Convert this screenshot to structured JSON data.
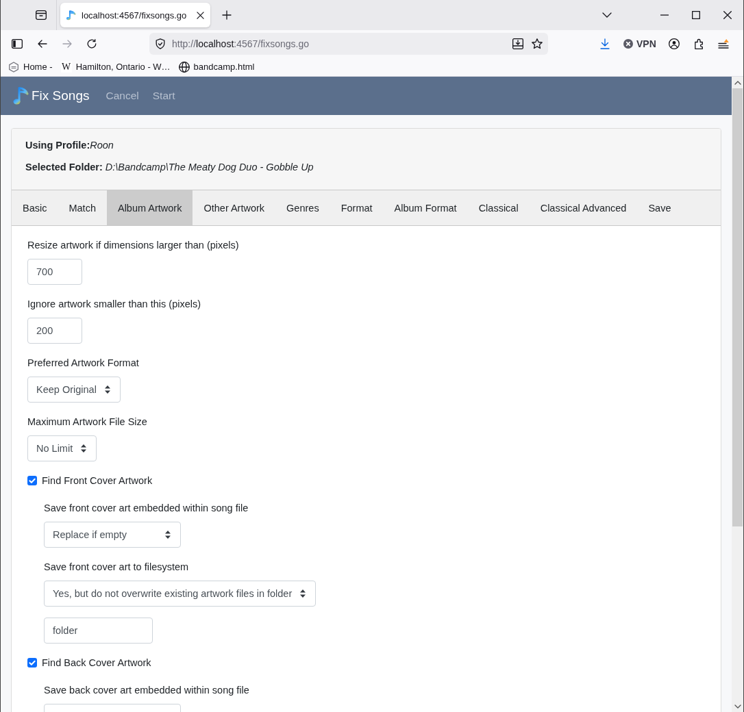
{
  "browser": {
    "tab_title": "localhost:4567/fixsongs.go",
    "address": {
      "scheme": "http://",
      "host": "localhost",
      "path": ":4567/fixsongs.go"
    },
    "forward_disabled": true,
    "vpn_label": "VPN",
    "menu_alert": true,
    "bookmarks": [
      {
        "kind": "hexagon",
        "label": "Home -"
      },
      {
        "kind": "letter",
        "icon_text": "W",
        "label": "Hamilton, Ontario - W…"
      },
      {
        "kind": "globe",
        "label": "bandcamp.html"
      }
    ]
  },
  "navbar": {
    "brand": "Fix Songs",
    "links": [
      "Cancel",
      "Start"
    ]
  },
  "summary": [
    {
      "label": "Using Profile:",
      "value": "Roon"
    },
    {
      "label": "Selected Folder: ",
      "value": "D:\\Bandcamp\\The Meaty Dog Duo - Gobble Up"
    }
  ],
  "tabs": [
    {
      "label": "Basic",
      "selected": false
    },
    {
      "label": "Match",
      "selected": false
    },
    {
      "label": "Album Artwork",
      "selected": true
    },
    {
      "label": "Other Artwork",
      "selected": false
    },
    {
      "label": "Genres",
      "selected": false
    },
    {
      "label": "Format",
      "selected": false
    },
    {
      "label": "Album Format",
      "selected": false
    },
    {
      "label": "Classical",
      "selected": false
    },
    {
      "label": "Classical Advanced",
      "selected": false
    },
    {
      "label": "Save",
      "selected": false
    }
  ],
  "form": [
    {
      "kind": "number",
      "label": "Resize artwork if dimensions larger than (pixels)",
      "value": "700"
    },
    {
      "kind": "number",
      "label": "Ignore artwork smaller than this (pixels)",
      "value": "200"
    },
    {
      "kind": "select",
      "label": "Preferred Artwork Format",
      "value": "Keep Original"
    },
    {
      "kind": "select",
      "label": "Maximum Artwork File Size",
      "value": "No Limit"
    },
    {
      "kind": "checkbox",
      "label": "Find Front Cover Artwork",
      "checked": true,
      "children": [
        {
          "kind": "select",
          "label": "Save front cover art embedded within song file",
          "value": "Replace if empty"
        },
        {
          "kind": "select",
          "label": "Save front cover art to filesystem",
          "value": "Yes, but do not overwrite existing artwork files in folder"
        },
        {
          "kind": "text",
          "value": "folder"
        }
      ]
    },
    {
      "kind": "checkbox",
      "label": "Find Back Cover Artwork",
      "checked": true,
      "children": [
        {
          "kind": "select",
          "label": "Save back cover art embedded within song file"
        }
      ]
    }
  ]
}
